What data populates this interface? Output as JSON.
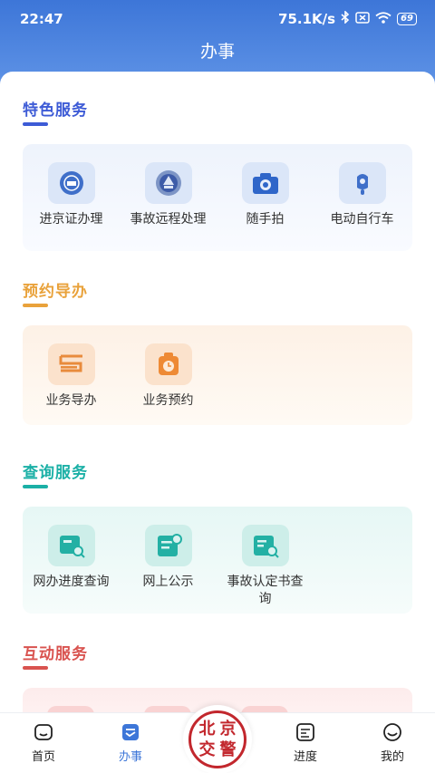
{
  "status": {
    "time": "22:47",
    "speed": "75.1K/s",
    "battery": "69",
    "icons": [
      "bluetooth-icon",
      "sim-off-icon",
      "wifi-icon"
    ]
  },
  "header": {
    "title": "办事"
  },
  "sections": {
    "featured": {
      "title": "特色服务",
      "color": "#3d5bd6",
      "items": [
        {
          "label": "进京证办理",
          "icon": "badge-icon"
        },
        {
          "label": "事故远程处理",
          "icon": "police-emblem-icon"
        },
        {
          "label": "随手拍",
          "icon": "camera-icon"
        },
        {
          "label": "电动自行车",
          "icon": "scooter-icon"
        }
      ]
    },
    "appointment": {
      "title": "预约导办",
      "color": "#e9a23b",
      "items": [
        {
          "label": "业务导办",
          "icon": "guide-icon"
        },
        {
          "label": "业务预约",
          "icon": "clock-box-icon"
        }
      ]
    },
    "query": {
      "title": "查询服务",
      "color": "#1bb0a6",
      "items": [
        {
          "label": "网办进度查询",
          "icon": "progress-search-icon"
        },
        {
          "label": "网上公示",
          "icon": "public-notice-icon"
        },
        {
          "label": "事故认定书查询",
          "icon": "document-search-icon"
        }
      ]
    },
    "interactive": {
      "title": "互动服务",
      "color": "#d9534f"
    }
  },
  "nav": {
    "home": "首页",
    "service": "办事",
    "progress": "进度",
    "mine": "我的",
    "seal_chars": [
      "北",
      "京",
      "交",
      "警"
    ]
  }
}
